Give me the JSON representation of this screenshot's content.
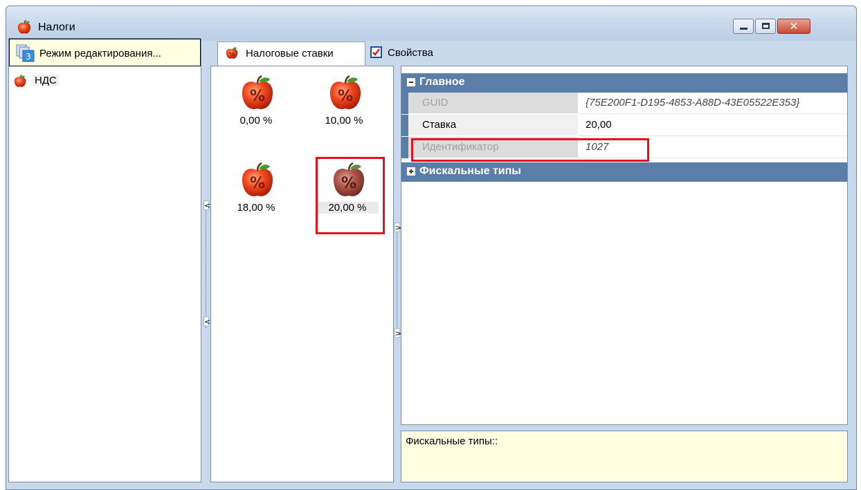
{
  "window": {
    "title": "Налоги",
    "close_glyph": "✕"
  },
  "left_panel": {
    "mode_button_label": "Режим редактирования...",
    "tree": [
      {
        "label": "НДС",
        "icon": "apple-icon"
      }
    ]
  },
  "tabs": [
    {
      "label": "Налоговые ставки",
      "icon": "apple-percent-icon",
      "active": true
    },
    {
      "label": "Свойства",
      "icon": "checkbox-icon",
      "active": false
    }
  ],
  "tax_rates": [
    {
      "label": "0,00 %",
      "selected": false
    },
    {
      "label": "10,00 %",
      "selected": false
    },
    {
      "label": "18,00 %",
      "selected": false
    },
    {
      "label": "20,00 %",
      "selected": true
    }
  ],
  "splitter_glyphs": {
    "left": "<",
    "right": ">"
  },
  "property_grid": {
    "categories": [
      {
        "label": "Главное",
        "expanded": true
      },
      {
        "label": "Фискальные типы",
        "expanded": false
      }
    ],
    "properties": [
      {
        "name": "GUID",
        "value": "{75E200F1-D195-4853-A88D-43E05522E353}",
        "readonly": true
      },
      {
        "name": "Ставка",
        "value": "20,00",
        "readonly": false
      },
      {
        "name": "Идентификатор",
        "value": "1027",
        "readonly": true
      }
    ]
  },
  "description": {
    "text": "Фискальные типы::"
  },
  "colors": {
    "category_header": "#5b7ea8",
    "highlight": "#e8101c",
    "description_bg": "#ffffe1"
  }
}
